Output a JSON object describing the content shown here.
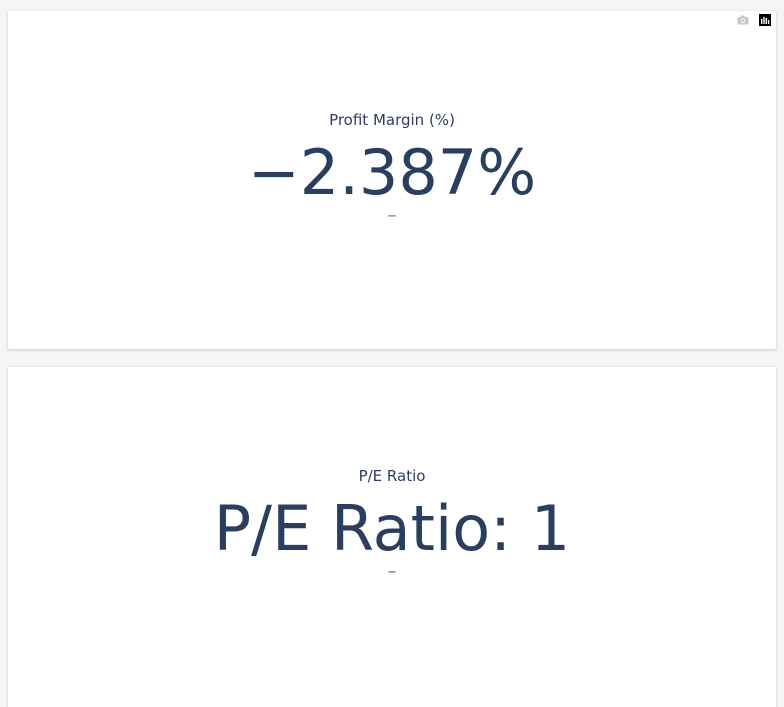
{
  "indicators": [
    {
      "title": "Profit Margin (%)",
      "value": "−2.387%",
      "delta": "–"
    },
    {
      "title": "P/E Ratio",
      "value": "P/E Ratio: 1",
      "delta": "–"
    }
  ],
  "modebar": {
    "icons": [
      "camera-icon",
      "plotly-logo-icon"
    ]
  },
  "colors": {
    "text": "#2a3f5f",
    "delta": "#3d9970",
    "modebar_inactive": "#c7c7c7",
    "logo_bg": "#000000"
  }
}
